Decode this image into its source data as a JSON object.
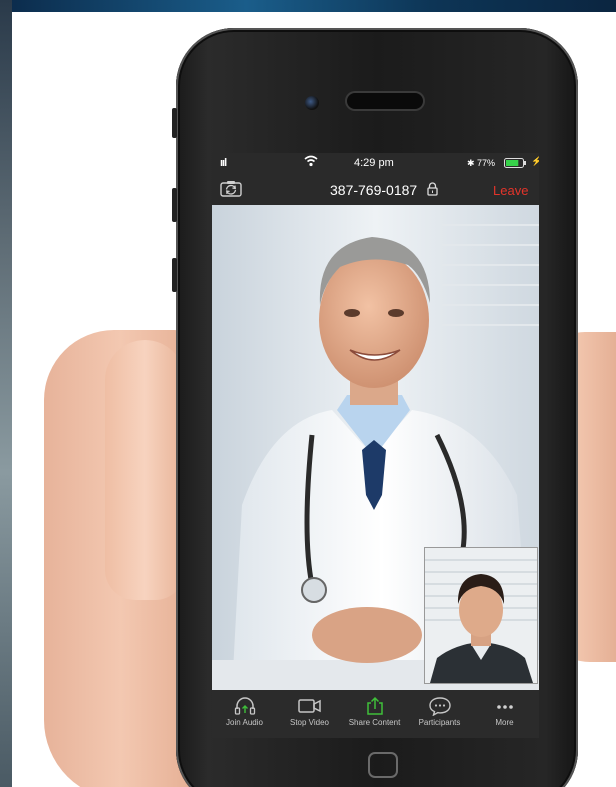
{
  "status_bar": {
    "signal": "ııl",
    "wifi": "wifi-icon",
    "time": "4:29 pm",
    "bluetooth": "✱",
    "battery_percent": "77%",
    "battery_level": 0.77
  },
  "meeting": {
    "id": "387-769-0187",
    "leave_label": "Leave"
  },
  "toolbar": {
    "join_audio_label": "Join Audio",
    "stop_video_label": "Stop Video",
    "share_content_label": "Share Content",
    "participants_label": "Participants",
    "more_label": "More"
  },
  "colors": {
    "leave": "#e3342a",
    "share_accent": "#3fbf3a",
    "battery": "#37d24a"
  }
}
